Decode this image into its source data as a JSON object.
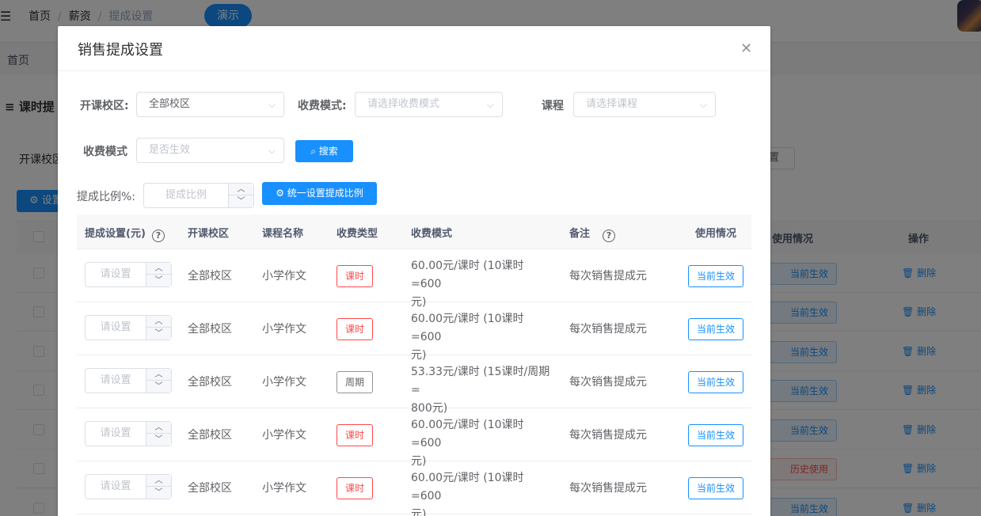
{
  "topbar": {
    "hamburger_icon": "menu-fold-icon",
    "breadcrumbs": [
      "首页",
      "薪资",
      "提成设置"
    ],
    "breadcrumb_sep": "/",
    "demo_label": "演示"
  },
  "tags": {
    "home": "首页"
  },
  "background": {
    "section_title": "课时提",
    "filter_label": "开课校区",
    "set_button": "设置",
    "reset_button": "置",
    "table_headers": {
      "usage": "使用情况",
      "action": "操作"
    },
    "rows": [
      {
        "status": "当前生效",
        "delete": "删除"
      },
      {
        "status": "当前生效",
        "delete": "删除"
      },
      {
        "status": "当前生效",
        "delete": "删除"
      },
      {
        "status": "当前生效",
        "delete": "删除"
      },
      {
        "status": "当前生效",
        "delete": "删除"
      },
      {
        "status": "历史使用",
        "delete": "删除"
      },
      {
        "status": "当前生效",
        "delete": "删除"
      }
    ]
  },
  "dialog": {
    "title": "销售提成设置",
    "close_icon": "close-icon",
    "filters": {
      "campus_label": "开课校区:",
      "campus_value": "全部校区",
      "mode_label": "收费模式:",
      "mode_placeholder": "请选择收费模式",
      "course_label": "课程",
      "course_placeholder": "请选择课程",
      "active_label": "收费模式",
      "active_placeholder": "是否生效",
      "search_button": "搜索"
    },
    "ratio": {
      "label": "提成比例%:",
      "placeholder": "提成比例",
      "unify_button": "统一设置提成比例"
    },
    "table": {
      "headers": {
        "commission": "提成设置(元)",
        "campus": "开课校区",
        "course": "课程名称",
        "type": "收费类型",
        "mode": "收费模式",
        "remark": "备注",
        "usage": "使用情况"
      },
      "input_placeholder": "请设置",
      "rows": [
        {
          "campus": "全部校区",
          "course": "小学作文",
          "type": "课时",
          "type_style": "danger",
          "mode_line1": "60.00元/课时 (10课时=600",
          "mode_line2": "元)",
          "remark": "每次销售提成元",
          "status": "当前生效"
        },
        {
          "campus": "全部校区",
          "course": "小学作文",
          "type": "课时",
          "type_style": "danger",
          "mode_line1": "60.00元/课时 (10课时=600",
          "mode_line2": "元)",
          "remark": "每次销售提成元",
          "status": "当前生效"
        },
        {
          "campus": "全部校区",
          "course": "小学作文",
          "type": "周期",
          "type_style": "info",
          "mode_line1": "53.33元/课时 (15课时/周期=",
          "mode_line2": "800元)",
          "remark": "每次销售提成元",
          "status": "当前生效"
        },
        {
          "campus": "全部校区",
          "course": "小学作文",
          "type": "课时",
          "type_style": "danger",
          "mode_line1": "60.00元/课时 (10课时=600",
          "mode_line2": "元)",
          "remark": "每次销售提成元",
          "status": "当前生效"
        },
        {
          "campus": "全部校区",
          "course": "小学作文",
          "type": "课时",
          "type_style": "danger",
          "mode_line1": "60.00元/课时 (10课时=600",
          "mode_line2": "元)",
          "remark": "每次销售提成元",
          "status": "当前生效"
        }
      ]
    }
  }
}
